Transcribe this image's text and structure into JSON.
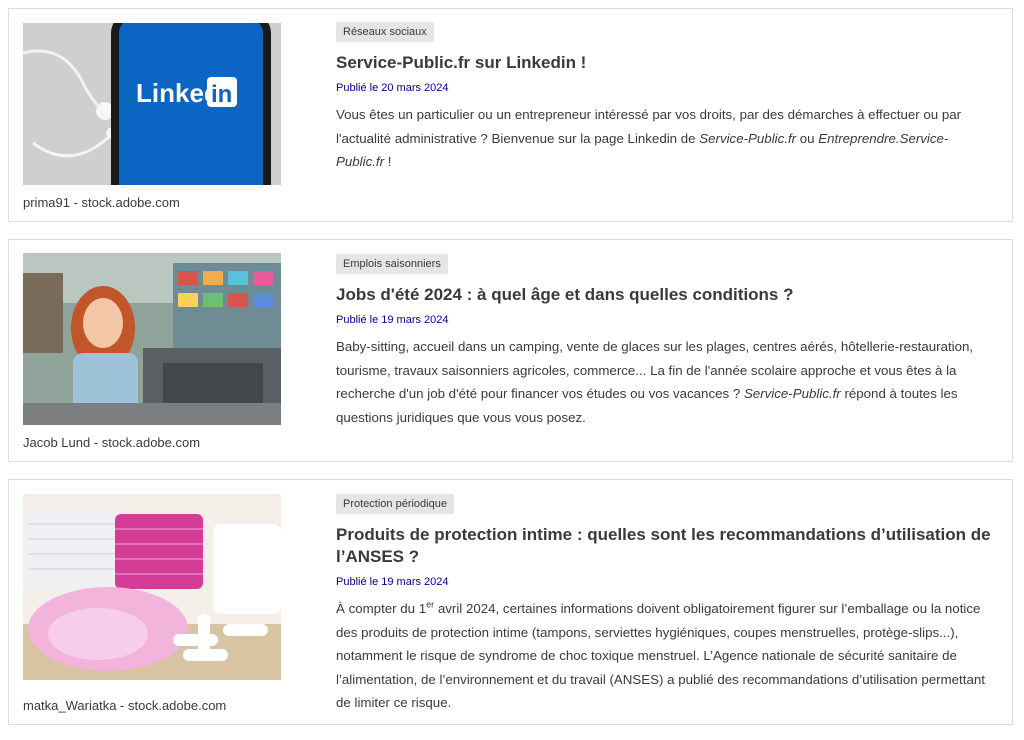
{
  "articles": [
    {
      "tag": "Réseaux sociaux",
      "title": "Service-Public.fr sur Linkedin !",
      "date_prefix": "Publié le ",
      "date": "20 mars 2024",
      "credit": "prima91 - stock.adobe.com",
      "image_text": "Linked",
      "image_text_box": "in",
      "desc_1": "Vous êtes un particulier ou un entrepreneur intéressé par vos droits, par des démarches à effectuer ou par l'actualité administrative ? Bienvenue sur la page Linkedin de ",
      "desc_em_1": "Service-Public.fr",
      "desc_2": " ou ",
      "desc_em_2": "Entreprendre.Service-Public.fr",
      "desc_3": " !"
    },
    {
      "tag": "Emplois saisonniers",
      "title": "Jobs d'été 2024 : à quel âge et dans quelles conditions ?",
      "date_prefix": "Publié le ",
      "date": "19 mars 2024",
      "credit": "Jacob Lund - stock.adobe.com",
      "desc_1": "Baby-sitting, accueil dans un camping, vente de glaces sur les plages, centres aérés, hôtellerie-restauration, tourisme, travaux saisonniers agricoles, commerce... La fin de l'année scolaire approche et vous êtes à la recherche d'un job d'été pour financer vos études ou vos vacances ? ",
      "desc_em_1": "Service-Public.fr",
      "desc_2": " répond à toutes les questions juridiques que vous vous posez."
    },
    {
      "tag": "Protection périodique",
      "title": "Produits de protection intime : quelles sont les recommandations d’utilisation de l’ANSES ?",
      "date_prefix": "Publié le ",
      "date": "19 mars 2024",
      "credit": "matka_Wariatka - stock.adobe.com",
      "desc_1": "À compter du 1",
      "desc_sup": "er",
      "desc_2": " avril 2024, certaines informations doivent obligatoirement figurer sur l’emballage ou la notice des produits de protection intime (tampons, serviettes hygiéniques, coupes menstruelles, protège-slips...), notamment le risque de syndrome de choc toxique menstruel. L’Agence nationale de sécurité sanitaire de l’alimentation, de l’environnement et du travail (ANSES) a publié des recommandations d’utilisation permettant de limiter ce risque."
    }
  ],
  "colors": {
    "date_blue": "#000091",
    "badge_bg": "#e5e5e5",
    "border": "#dddddd",
    "linkedin_blue": "#0a66c2"
  }
}
